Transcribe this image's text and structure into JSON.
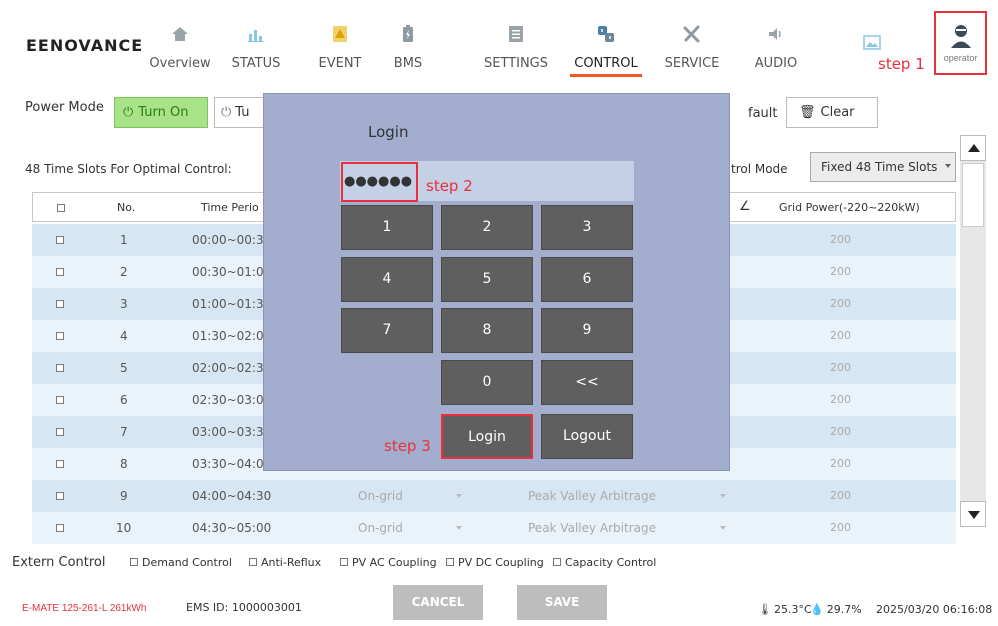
{
  "brand": "EENOVANCE",
  "colors": {
    "accent": "#f15a24",
    "annotation": "#e8313a",
    "turn_on_bg": "#a8e38a",
    "modal_bg": "#a3aecf"
  },
  "nav": [
    {
      "label": "Overview",
      "icon": "home-icon"
    },
    {
      "label": "STATUS",
      "icon": "chart-icon"
    },
    {
      "label": "EVENT",
      "icon": "warning-icon"
    },
    {
      "label": "BMS",
      "icon": "battery-icon"
    },
    {
      "label": "SETTINGS",
      "icon": "settings-list-icon"
    },
    {
      "label": "CONTROL",
      "icon": "control-icon",
      "active": true
    },
    {
      "label": "SERVICE",
      "icon": "tools-icon"
    },
    {
      "label": "AUDIO",
      "icon": "speaker-icon"
    },
    {
      "label": "",
      "icon": "image-icon"
    }
  ],
  "operator_label": "operator",
  "steps": {
    "step1": "step 1",
    "step2": "step 2",
    "step3": "step 3"
  },
  "power_mode": {
    "label": "Power Mode",
    "turn_on": "Turn On",
    "turn_off": "Tu"
  },
  "fault": {
    "label": "fault",
    "clear": "Clear"
  },
  "slots": {
    "label": "48 Time Slots For Optimal Control:",
    "control_mode_label": "trol Mode",
    "control_mode_value": "Fixed 48 Time Slots"
  },
  "table": {
    "headers": {
      "no": "No.",
      "time": "Time Perio",
      "grid": "Grid Power(-220~220kW)"
    },
    "rows": [
      {
        "no": "1",
        "time": "00:00~00:3",
        "grid": "200"
      },
      {
        "no": "2",
        "time": "00:30~01:0",
        "grid": "200"
      },
      {
        "no": "3",
        "time": "01:00~01:3",
        "grid": "200"
      },
      {
        "no": "4",
        "time": "01:30~02:0",
        "grid": "200"
      },
      {
        "no": "5",
        "time": "02:00~02:3",
        "grid": "200"
      },
      {
        "no": "6",
        "time": "02:30~03:0",
        "grid": "200"
      },
      {
        "no": "7",
        "time": "03:00~03:3",
        "grid": "200"
      },
      {
        "no": "8",
        "time": "03:30~04:0",
        "grid": "200"
      },
      {
        "no": "9",
        "time": "04:00~04:30",
        "mode": "On-grid",
        "strategy": "Peak Valley Arbitrage",
        "grid": "200"
      },
      {
        "no": "10",
        "time": "04:30~05:00",
        "mode": "On-grid",
        "strategy": "Peak Valley Arbitrage",
        "grid": "200"
      }
    ]
  },
  "extern": {
    "label": "Extern Control",
    "options": [
      "Demand Control",
      "Anti-Reflux",
      "PV AC Coupling",
      "PV DC Coupling",
      "Capacity Control"
    ]
  },
  "footer": {
    "model": "E-MATE 125-261-L 261kWh",
    "ems_id": "EMS ID: 1000003001",
    "cancel": "CANCEL",
    "save": "SAVE",
    "temp": "25.3°C",
    "humidity": "29.7%",
    "datetime": "2025/03/20 06:16:08"
  },
  "login": {
    "title": "Login",
    "password_mask": "●●●●●●",
    "keys": [
      "1",
      "2",
      "3",
      "4",
      "5",
      "6",
      "7",
      "8",
      "9",
      "0",
      "<<"
    ],
    "login_btn": "Login",
    "logout_btn": "Logout"
  }
}
